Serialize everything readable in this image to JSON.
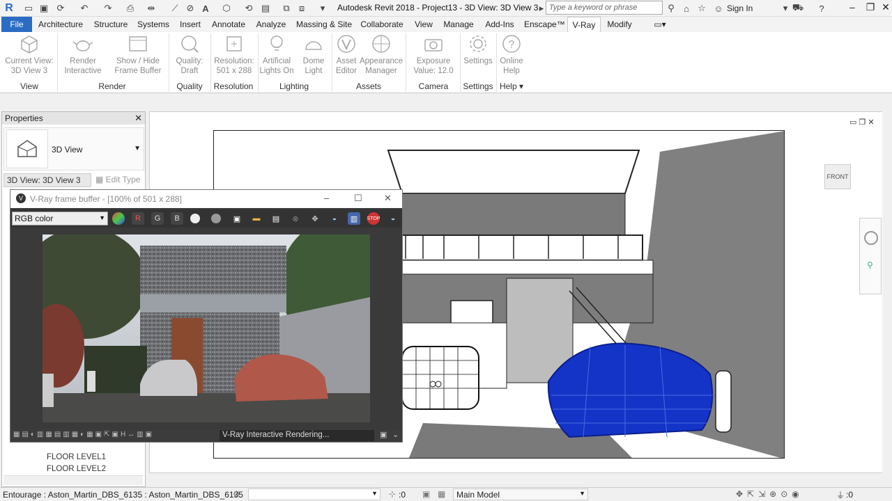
{
  "titlebar": {
    "title": "Autodesk Revit 2018 -    Project13 - 3D View: 3D View 3",
    "search_placeholder": "Type a keyword or phrase",
    "signin": "Sign In"
  },
  "tabs": [
    "File",
    "Architecture",
    "Structure",
    "Systems",
    "Insert",
    "Annotate",
    "Analyze",
    "Massing & Site",
    "Collaborate",
    "View",
    "Manage",
    "Add-Ins",
    "Enscape™",
    "V-Ray",
    "Modify"
  ],
  "ribbon": {
    "buttons": [
      {
        "line1": "Current View:",
        "line2": "3D View 3"
      },
      {
        "line1": "Render",
        "line2": "Interactive"
      },
      {
        "line1": "Show / Hide",
        "line2": "Frame Buffer"
      },
      {
        "line1": "Quality:",
        "line2": "Draft"
      },
      {
        "line1": "Resolution:",
        "line2": "501 x 288"
      },
      {
        "line1": "Artificial",
        "line2": "Lights On"
      },
      {
        "line1": "Dome",
        "line2": "Light"
      },
      {
        "line1": "Asset",
        "line2": "Editor"
      },
      {
        "line1": "Appearance",
        "line2": "Manager"
      },
      {
        "line1": "Exposure",
        "line2": "Value: 12.0"
      },
      {
        "line1": "Settings",
        "line2": ""
      },
      {
        "line1": "Online",
        "line2": "Help"
      }
    ],
    "groups": [
      "View",
      "Render",
      "Quality",
      "Resolution",
      "Lighting",
      "Assets",
      "Camera",
      "Settings",
      "Help"
    ]
  },
  "properties": {
    "title": "Properties",
    "type_label": "3D View",
    "view_selector": "3D View: 3D View 3",
    "edit_type": "Edit Type",
    "browser_rows": [
      "FLOOR LEVEL1",
      "FLOOR LEVEL2"
    ]
  },
  "vfb": {
    "title": "V-Ray frame buffer - [100% of 501 x 288]",
    "channel": "RGB color",
    "status": "V-Ray Interactive Rendering..."
  },
  "view": {
    "viewcube_label": "FRONT"
  },
  "statusbar": {
    "text": "Entourage : Aston_Martin_DBS_6135 : Aston_Martin_DBS_6135",
    "selection_count": ":0",
    "model": "Main Model",
    "filter_count": ":0"
  },
  "colors": {
    "accent": "#2a6cc4",
    "car_highlight": "#1434c8"
  }
}
